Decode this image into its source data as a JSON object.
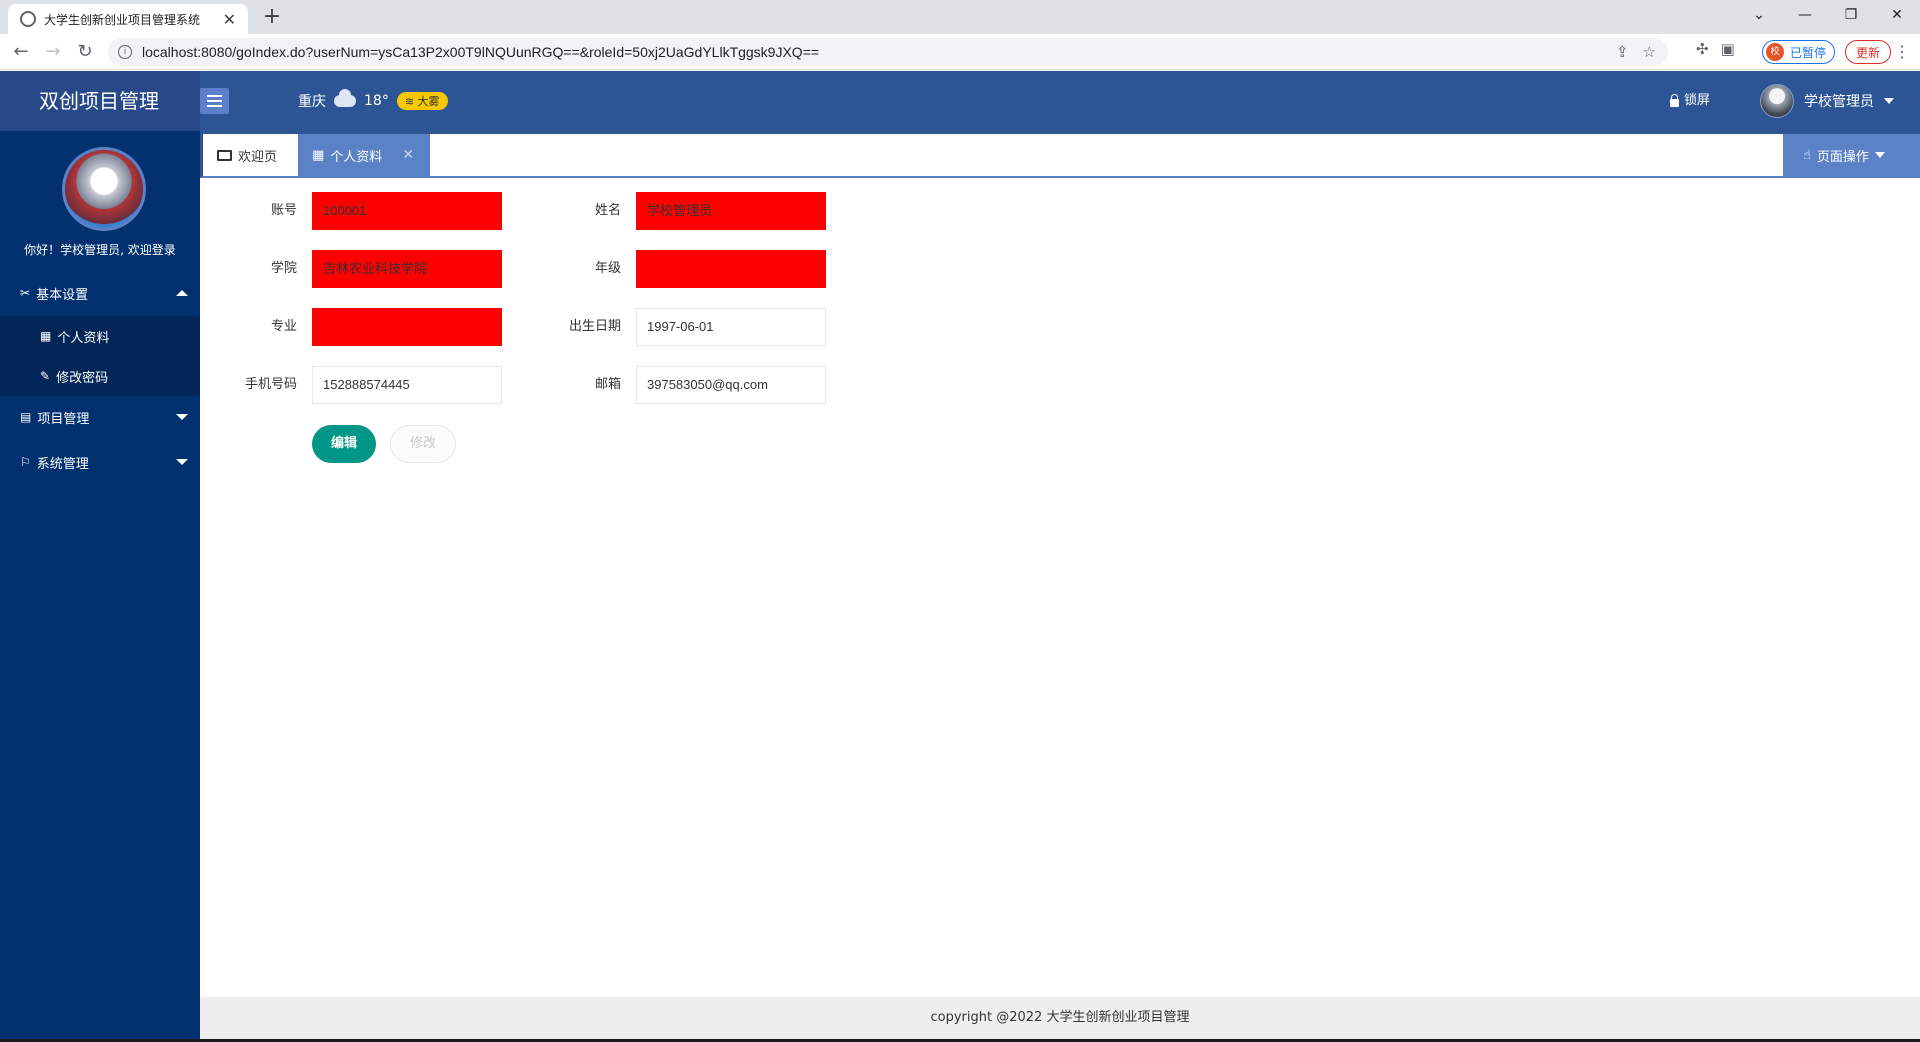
{
  "browser": {
    "tab_title": "大学生创新创业项目管理系统",
    "url": "localhost:8080/goIndex.do?userNum=ysCa13P2x00T9lNQUunRGQ==&roleId=50xj2UaGdYLlkTggsk9JXQ==",
    "profile_label": "已暂停",
    "profile_avatar_text": "校",
    "update_label": "更新"
  },
  "header": {
    "logo": "双创项目管理",
    "city": "重庆",
    "temperature": "18°",
    "weather_badge": "大雾",
    "lock_label": "锁屏",
    "user_name": "学校管理员"
  },
  "sidebar": {
    "welcome": "你好！学校管理员, 欢迎登录",
    "groups": [
      {
        "label": "基本设置",
        "icon": "tools-icon",
        "expanded": true,
        "items": [
          {
            "label": "个人资料",
            "icon": "calendar-icon"
          },
          {
            "label": "修改密码",
            "icon": "pencil-icon"
          }
        ]
      },
      {
        "label": "项目管理",
        "icon": "document-icon",
        "expanded": false
      },
      {
        "label": "系统管理",
        "icon": "flag-icon",
        "expanded": false
      }
    ]
  },
  "tabs": {
    "home": "欢迎页",
    "active": "个人资料",
    "page_ops": "页面操作"
  },
  "form": {
    "account_label": "账号",
    "account_value": "100001",
    "name_label": "姓名",
    "name_value": "学校管理员",
    "college_label": "学院",
    "college_value": "吉林农业科技学院",
    "grade_label": "年级",
    "grade_value": "",
    "major_label": "专业",
    "major_value": "",
    "birth_label": "出生日期",
    "birth_value": "1997-06-01",
    "phone_label": "手机号码",
    "phone_value": "152888574445",
    "email_label": "邮箱",
    "email_value": "397583050@qq.com",
    "edit_button": "编辑",
    "modify_button": "修改"
  },
  "footer": "copyright @2022 大学生创新创业项目管理",
  "colors": {
    "header": "#2d5596",
    "sidebar": "#033170",
    "accent": "#5b82c7",
    "primary_button": "#009688",
    "highlight_field": "#ff0000"
  }
}
